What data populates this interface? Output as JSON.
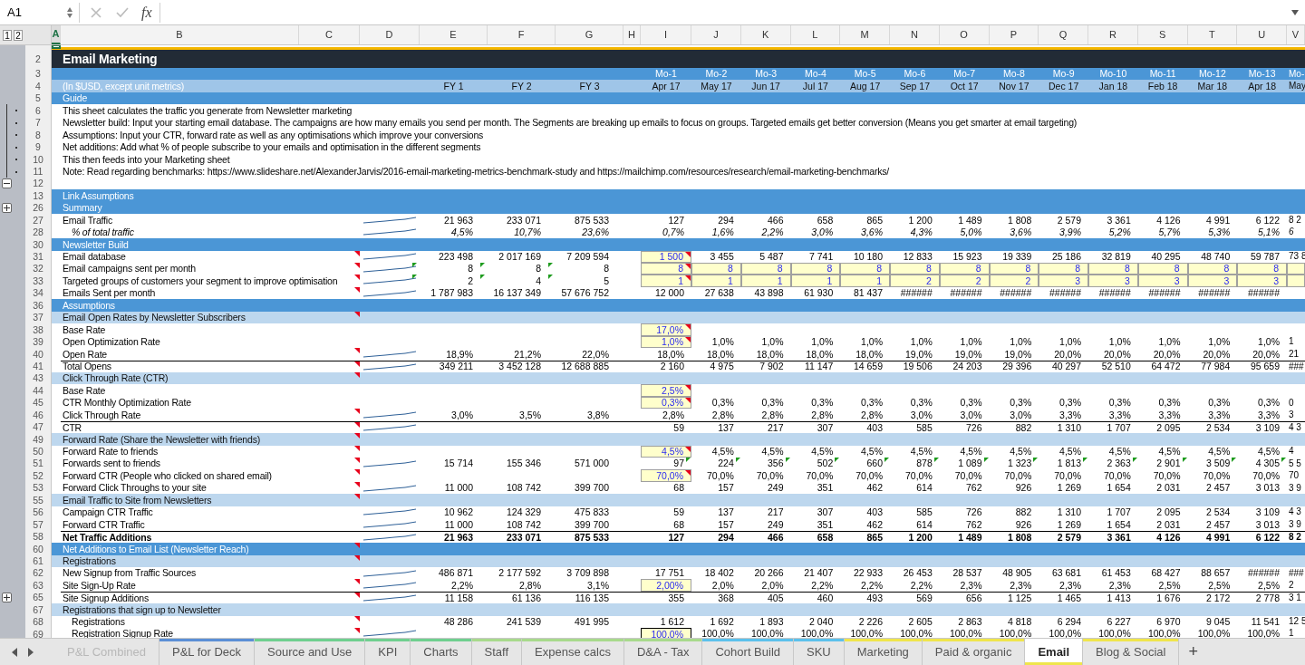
{
  "name_box": "A1",
  "formula_button": "fx",
  "outline_levels": [
    "1",
    "2"
  ],
  "columns": [
    {
      "label": "A",
      "selected": true
    },
    {
      "label": "B",
      "selected": false
    },
    {
      "label": "C",
      "selected": false
    },
    {
      "label": "D",
      "selected": false
    },
    {
      "label": "E",
      "selected": false
    },
    {
      "label": "F",
      "selected": false
    },
    {
      "label": "G",
      "selected": false
    },
    {
      "label": "H",
      "selected": false
    },
    {
      "label": "I",
      "selected": false
    },
    {
      "label": "J",
      "selected": false
    },
    {
      "label": "K",
      "selected": false
    },
    {
      "label": "L",
      "selected": false
    },
    {
      "label": "M",
      "selected": false
    },
    {
      "label": "N",
      "selected": false
    },
    {
      "label": "O",
      "selected": false
    },
    {
      "label": "P",
      "selected": false
    },
    {
      "label": "Q",
      "selected": false
    },
    {
      "label": "R",
      "selected": false
    },
    {
      "label": "S",
      "selected": false
    },
    {
      "label": "T",
      "selected": false
    },
    {
      "label": "U",
      "selected": false
    },
    {
      "label": "V",
      "selected": false
    }
  ],
  "rows": [
    {
      "kind": "top"
    },
    {
      "num": "2",
      "kind": "title",
      "label": "Email Marketing"
    },
    {
      "num": "3",
      "kind": "band",
      "months": [
        "Mo-1",
        "Mo-2",
        "Mo-3",
        "Mo-4",
        "Mo-5",
        "Mo-6",
        "Mo-7",
        "Mo-8",
        "Mo-9",
        "Mo-10",
        "Mo-11",
        "Mo-12",
        "Mo-13",
        "Mo-"
      ]
    },
    {
      "num": "4",
      "kind": "header",
      "label": "(In $USD, except unit metrics)",
      "fy": [
        "FY 1",
        "FY 2",
        "FY 3"
      ],
      "months": [
        "Apr 17",
        "May 17",
        "Jun 17",
        "Jul 17",
        "Aug 17",
        "Sep 17",
        "Oct 17",
        "Nov 17",
        "Dec 17",
        "Jan 18",
        "Feb 18",
        "Mar 18",
        "Apr 18",
        "May"
      ]
    },
    {
      "num": "5",
      "kind": "band",
      "label": "Guide"
    },
    {
      "num": "6",
      "kind": "text",
      "group_dot": true,
      "label": "This sheet calculates the traffic you generate from Newsletter marketing"
    },
    {
      "num": "7",
      "kind": "text",
      "group_dot": true,
      "label": "Newsletter build: Input your starting email database. The campaigns are how many emails you send per month. The Segments are breaking up emails to focus on groups. Targeted emails get better conversion (Means you get smarter at email targeting)"
    },
    {
      "num": "8",
      "kind": "text",
      "group_dot": true,
      "label": "Assumptions: Input your CTR, forward rate as well as any optimisations which improve your conversions"
    },
    {
      "num": "9",
      "kind": "text",
      "group_dot": true,
      "label": "Net additions: Add what % of people subscribe to your emails and optimisation in the different segments"
    },
    {
      "num": "10",
      "kind": "text",
      "group_dot": true,
      "label": "This then feeds into your Marketing sheet"
    },
    {
      "num": "11",
      "kind": "text",
      "group_dot": true,
      "label": "Note: Read regarding benchmarks: https://www.slideshare.net/AlexanderJarvis/2016-email-marketing-metrics-benchmark-study and https://mailchimp.com/resources/research/email-marketing-benchmarks/"
    },
    {
      "num": "12",
      "kind": "blank",
      "group_collapse": true
    },
    {
      "num": "13",
      "kind": "band",
      "label": "Link Assumptions"
    },
    {
      "num": "26",
      "kind": "band",
      "label": "Summary",
      "group_expand": true
    },
    {
      "num": "27",
      "kind": "data",
      "label": "Email Traffic",
      "sparkline": true,
      "fy": [
        "21 963",
        "233 071",
        "875 533"
      ],
      "months": [
        "127",
        "294",
        "466",
        "658",
        "865",
        "1 200",
        "1 489",
        "1 808",
        "2 579",
        "3 361",
        "4 126",
        "4 991",
        "6 122",
        "8 2"
      ]
    },
    {
      "num": "28",
      "kind": "data",
      "label": "% of total traffic",
      "indent": true,
      "italic": true,
      "sparkline": true,
      "fy": [
        "4,5%",
        "10,7%",
        "23,6%"
      ],
      "months": [
        "0,7%",
        "1,6%",
        "2,2%",
        "3,0%",
        "3,6%",
        "4,3%",
        "5,0%",
        "3,6%",
        "3,9%",
        "5,2%",
        "5,7%",
        "5,3%",
        "5,1%",
        "6"
      ]
    },
    {
      "num": "30",
      "kind": "band",
      "label": "Newsletter Build"
    },
    {
      "num": "31",
      "kind": "data",
      "label": "Email database",
      "comment": true,
      "sparkline": true,
      "fy": [
        "223 498",
        "2 017 169",
        "7 209 594"
      ],
      "input_first": true,
      "input_note": true,
      "months": [
        "1 500",
        "3 455",
        "5 487",
        "7 741",
        "10 180",
        "12 833",
        "15 923",
        "19 339",
        "25 186",
        "32 819",
        "40 295",
        "48 740",
        "59 787",
        "73 8"
      ]
    },
    {
      "num": "32",
      "kind": "data",
      "label": "Email campaigns sent per month",
      "comment": true,
      "sparkline": true,
      "fy_flag": true,
      "fy": [
        "8",
        "8",
        "8"
      ],
      "input_all": true,
      "input_note": true,
      "months": [
        "8",
        "8",
        "8",
        "8",
        "8",
        "8",
        "8",
        "8",
        "8",
        "8",
        "8",
        "8",
        "8"
      ]
    },
    {
      "num": "33",
      "kind": "data",
      "label": "Targeted groups of customers your segment to improve optimisation",
      "comment": true,
      "sparkline": true,
      "fy_flag": true,
      "fy": [
        "2",
        "4",
        "5"
      ],
      "input_all": true,
      "input_note": true,
      "months": [
        "1",
        "1",
        "1",
        "1",
        "1",
        "2",
        "2",
        "2",
        "3",
        "3",
        "3",
        "3",
        "3"
      ]
    },
    {
      "num": "34",
      "kind": "data",
      "label": "Emails Sent per month",
      "comment": true,
      "sparkline": true,
      "fy": [
        "1 787 983",
        "16 137 349",
        "57 676 752"
      ],
      "months": [
        "12 000",
        "27 638",
        "43 898",
        "61 930",
        "81 437",
        "######",
        "######",
        "######",
        "######",
        "######",
        "######",
        "######",
        "######"
      ]
    },
    {
      "num": "36",
      "kind": "band",
      "label": "Assumptions"
    },
    {
      "num": "37",
      "kind": "sub",
      "label": "Email Open Rates by Newsletter Subscribers",
      "comment": true
    },
    {
      "num": "38",
      "kind": "data",
      "label": "Base Rate",
      "input_first": true,
      "input_note": true,
      "months": [
        "17,0%"
      ]
    },
    {
      "num": "39",
      "kind": "data",
      "label": "Open Optimization Rate",
      "input_first": true,
      "input_note": true,
      "months": [
        "1,0%",
        "1,0%",
        "1,0%",
        "1,0%",
        "1,0%",
        "1,0%",
        "1,0%",
        "1,0%",
        "1,0%",
        "1,0%",
        "1,0%",
        "1,0%",
        "1,0%",
        "1"
      ]
    },
    {
      "num": "40",
      "kind": "data",
      "label": "Open Rate",
      "comment": true,
      "sparkline": true,
      "fy": [
        "18,9%",
        "21,2%",
        "22,0%"
      ],
      "months": [
        "18,0%",
        "18,0%",
        "18,0%",
        "18,0%",
        "18,0%",
        "19,0%",
        "19,0%",
        "19,0%",
        "20,0%",
        "20,0%",
        "20,0%",
        "20,0%",
        "20,0%",
        "21"
      ]
    },
    {
      "num": "41",
      "kind": "data",
      "label": "Total Opens",
      "rule_top": true,
      "comment": true,
      "sparkline": true,
      "fy": [
        "349 211",
        "3 452 128",
        "12 688 885"
      ],
      "months": [
        "2 160",
        "4 975",
        "7 902",
        "11 147",
        "14 659",
        "19 506",
        "24 203",
        "29 396",
        "40 297",
        "52 510",
        "64 472",
        "77 984",
        "95 659",
        "###"
      ]
    },
    {
      "num": "43",
      "kind": "sub",
      "label": "Click Through Rate (CTR)",
      "comment": true
    },
    {
      "num": "44",
      "kind": "data",
      "label": "Base Rate",
      "input_first": true,
      "input_note": true,
      "months": [
        "2,5%"
      ]
    },
    {
      "num": "45",
      "kind": "data",
      "label": "CTR Monthly Optimization Rate",
      "input_first": true,
      "input_note": true,
      "months": [
        "0,3%",
        "0,3%",
        "0,3%",
        "0,3%",
        "0,3%",
        "0,3%",
        "0,3%",
        "0,3%",
        "0,3%",
        "0,3%",
        "0,3%",
        "0,3%",
        "0,3%",
        "0"
      ]
    },
    {
      "num": "46",
      "kind": "data",
      "label": "Click Through Rate",
      "comment": true,
      "sparkline": true,
      "fy": [
        "3,0%",
        "3,5%",
        "3,8%"
      ],
      "months": [
        "2,8%",
        "2,8%",
        "2,8%",
        "2,8%",
        "2,8%",
        "3,0%",
        "3,0%",
        "3,0%",
        "3,3%",
        "3,3%",
        "3,3%",
        "3,3%",
        "3,3%",
        "3"
      ]
    },
    {
      "num": "47",
      "kind": "data",
      "label": "CTR",
      "rule_top": true,
      "comment": true,
      "sparkline": true,
      "months": [
        "59",
        "137",
        "217",
        "307",
        "403",
        "585",
        "726",
        "882",
        "1 310",
        "1 707",
        "2 095",
        "2 534",
        "3 109",
        "4 3"
      ]
    },
    {
      "num": "49",
      "kind": "sub",
      "label": "Forward Rate (Share the Newsletter with friends)",
      "comment": true
    },
    {
      "num": "50",
      "kind": "data",
      "label": "Forward Rate to friends",
      "comment": true,
      "input_first": true,
      "input_note": true,
      "months": [
        "4,5%",
        "4,5%",
        "4,5%",
        "4,5%",
        "4,5%",
        "4,5%",
        "4,5%",
        "4,5%",
        "4,5%",
        "4,5%",
        "4,5%",
        "4,5%",
        "4,5%",
        "4"
      ]
    },
    {
      "num": "51",
      "kind": "data",
      "label": "Forwards sent to friends",
      "comment": true,
      "sparkline": true,
      "month_flag": true,
      "fy": [
        "15 714",
        "155 346",
        "571 000"
      ],
      "months": [
        "97",
        "224",
        "356",
        "502",
        "660",
        "878",
        "1 089",
        "1 323",
        "1 813",
        "2 363",
        "2 901",
        "3 509",
        "4 305",
        "5 5"
      ]
    },
    {
      "num": "52",
      "kind": "data",
      "label": "Forward CTR (People who clicked on shared email)",
      "comment": true,
      "input_first": true,
      "input_note": true,
      "months": [
        "70,0%",
        "70,0%",
        "70,0%",
        "70,0%",
        "70,0%",
        "70,0%",
        "70,0%",
        "70,0%",
        "70,0%",
        "70,0%",
        "70,0%",
        "70,0%",
        "70,0%",
        "70"
      ]
    },
    {
      "num": "53",
      "kind": "data",
      "label": "Forward Click Throughs to your site",
      "comment": true,
      "sparkline": true,
      "fy": [
        "11 000",
        "108 742",
        "399 700"
      ],
      "months": [
        "68",
        "157",
        "249",
        "351",
        "462",
        "614",
        "762",
        "926",
        "1 269",
        "1 654",
        "2 031",
        "2 457",
        "3 013",
        "3 9"
      ]
    },
    {
      "num": "55",
      "kind": "sub",
      "label": "Email Traffic to Site from Newsletters",
      "comment": true
    },
    {
      "num": "56",
      "kind": "data",
      "label": "Campaign CTR Traffic",
      "sparkline": true,
      "fy": [
        "10 962",
        "124 329",
        "475 833"
      ],
      "months": [
        "59",
        "137",
        "217",
        "307",
        "403",
        "585",
        "726",
        "882",
        "1 310",
        "1 707",
        "2 095",
        "2 534",
        "3 109",
        "4 3"
      ]
    },
    {
      "num": "57",
      "kind": "data",
      "label": "Forward CTR Traffic",
      "sparkline": true,
      "fy": [
        "11 000",
        "108 742",
        "399 700"
      ],
      "months": [
        "68",
        "157",
        "249",
        "351",
        "462",
        "614",
        "762",
        "926",
        "1 269",
        "1 654",
        "2 031",
        "2 457",
        "3 013",
        "3 9"
      ]
    },
    {
      "num": "58",
      "kind": "data",
      "label": "Net Traffic Additions",
      "bold": true,
      "rule_top": true,
      "sparkline": true,
      "fy": [
        "21 963",
        "233 071",
        "875 533"
      ],
      "months": [
        "127",
        "294",
        "466",
        "658",
        "865",
        "1 200",
        "1 489",
        "1 808",
        "2 579",
        "3 361",
        "4 126",
        "4 991",
        "6 122",
        "8 2"
      ]
    },
    {
      "num": "60",
      "kind": "band",
      "label": "Net Additions to Email List (Newsletter Reach)",
      "comment": true
    },
    {
      "num": "61",
      "kind": "sub",
      "label": "Registrations",
      "comment": true
    },
    {
      "num": "62",
      "kind": "data",
      "label": "New Signup from Traffic Sources",
      "sparkline": true,
      "fy": [
        "486 871",
        "2 177 592",
        "3 709 898"
      ],
      "months": [
        "17 751",
        "18 402",
        "20 266",
        "21 407",
        "22 933",
        "26 453",
        "28 537",
        "48 905",
        "63 681",
        "61 453",
        "68 427",
        "88 657",
        "######",
        "###"
      ]
    },
    {
      "num": "63",
      "kind": "data",
      "label": "Site Sign-Up Rate",
      "comment": true,
      "sparkline": true,
      "fy": [
        "2,2%",
        "2,8%",
        "3,1%"
      ],
      "input_first": true,
      "months": [
        "2,00%",
        "2,0%",
        "2,0%",
        "2,2%",
        "2,2%",
        "2,2%",
        "2,3%",
        "2,3%",
        "2,3%",
        "2,3%",
        "2,5%",
        "2,5%",
        "2,5%",
        "2"
      ]
    },
    {
      "num": "65",
      "kind": "data",
      "label": "Site Signup Additions",
      "group_expand": true,
      "rule_top": true,
      "comment": true,
      "sparkline": true,
      "fy": [
        "11 158",
        "61 136",
        "116 135"
      ],
      "months": [
        "355",
        "368",
        "405",
        "460",
        "493",
        "569",
        "656",
        "1 125",
        "1 465",
        "1 413",
        "1 676",
        "2 172",
        "2 778",
        "3 1"
      ]
    },
    {
      "num": "67",
      "kind": "sub",
      "label": "Registrations that sign up to Newsletter"
    },
    {
      "num": "68",
      "kind": "data",
      "label": "Registrations",
      "indent": true,
      "comment": true,
      "fy": [
        "48 286",
        "241 539",
        "491 995"
      ],
      "months": [
        "1 612",
        "1 692",
        "1 893",
        "2 040",
        "2 226",
        "2 605",
        "2 863",
        "4 818",
        "6 294",
        "6 227",
        "6 970",
        "9 045",
        "11 541",
        "12 5"
      ]
    },
    {
      "num": "69",
      "kind": "data",
      "label": "Registration Signup Rate",
      "indent": true,
      "rule_bottom": true,
      "comment": true,
      "sparkline": true,
      "input_first": true,
      "months": [
        "100,0%",
        "100,0%",
        "100,0%",
        "100,0%",
        "100,0%",
        "100,0%",
        "100,0%",
        "100,0%",
        "100,0%",
        "100,0%",
        "100,0%",
        "100,0%",
        "100,0%",
        "1"
      ]
    }
  ],
  "sheet_tabs": [
    {
      "label": "P&L Combined",
      "selected": false,
      "dimmed": true
    },
    {
      "label": "P&L for Deck",
      "selected": false,
      "dimmed": false,
      "color": "#5b8fd6"
    },
    {
      "label": "Source and Use",
      "selected": false,
      "dimmed": false,
      "color": "#6fcf8f"
    },
    {
      "label": "KPI",
      "selected": false,
      "dimmed": false,
      "color": "#6fcf8f"
    },
    {
      "label": "Charts",
      "selected": false,
      "dimmed": false,
      "color": "#6fcf8f"
    },
    {
      "label": "Staff",
      "selected": false,
      "dimmed": false,
      "color": "#a8da8c"
    },
    {
      "label": "Expense calcs",
      "selected": false,
      "dimmed": false,
      "color": "#a8da8c"
    },
    {
      "label": "D&A - Tax",
      "selected": false,
      "dimmed": false,
      "color": "#a8da8c"
    },
    {
      "label": "Cohort Build",
      "selected": false,
      "dimmed": false,
      "color": "#5cc1ec"
    },
    {
      "label": "SKU",
      "selected": false,
      "dimmed": false,
      "color": "#5cc1ec"
    },
    {
      "label": "Marketing",
      "selected": false,
      "dimmed": false,
      "color": "#efe54c"
    },
    {
      "label": "Paid & organic",
      "selected": false,
      "dimmed": false,
      "color": "#efe54c"
    },
    {
      "label": "Email",
      "selected": true,
      "dimmed": false,
      "color": "#efe54c"
    },
    {
      "label": "Blog & Social",
      "selected": false,
      "dimmed": false,
      "color": "#efe54c"
    }
  ],
  "add_sheet": "+"
}
